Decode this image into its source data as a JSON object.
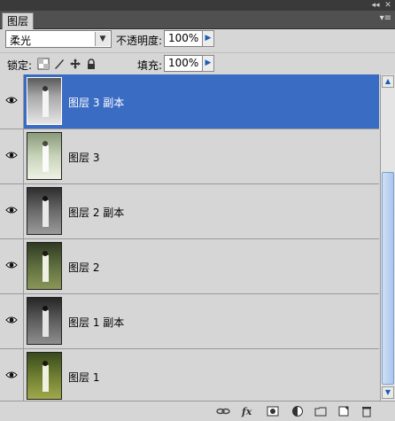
{
  "window": {
    "collapse_icon": "double-chevron-icon",
    "close_icon": "close-icon"
  },
  "panel": {
    "tab_label": "图层",
    "menu_icon": "panel-menu-icon"
  },
  "blend": {
    "mode": "柔光",
    "opacity_label": "不透明度:",
    "opacity_value": "100%"
  },
  "locks": {
    "label": "锁定:",
    "fill_label": "填充:",
    "fill_value": "100%"
  },
  "layers": [
    {
      "name": "图层 3 副本",
      "selected": true,
      "tone": "gray"
    },
    {
      "name": "图层 3",
      "selected": false,
      "tone": "lightgreen"
    },
    {
      "name": "图层 2 副本",
      "selected": false,
      "tone": "gray"
    },
    {
      "name": "图层 2",
      "selected": false,
      "tone": "green"
    },
    {
      "name": "图层 1 副本",
      "selected": false,
      "tone": "gray"
    },
    {
      "name": "图层 1",
      "selected": false,
      "tone": "green"
    }
  ],
  "bottom_icons": [
    "link-layers-icon",
    "fx-icon",
    "add-mask-icon",
    "adjustment-layer-icon",
    "new-group-icon",
    "new-layer-icon",
    "delete-icon"
  ],
  "colors": {
    "selection": "#3a6cc4",
    "panel_bg": "#d6d6d6",
    "tab_bar": "#505050"
  }
}
